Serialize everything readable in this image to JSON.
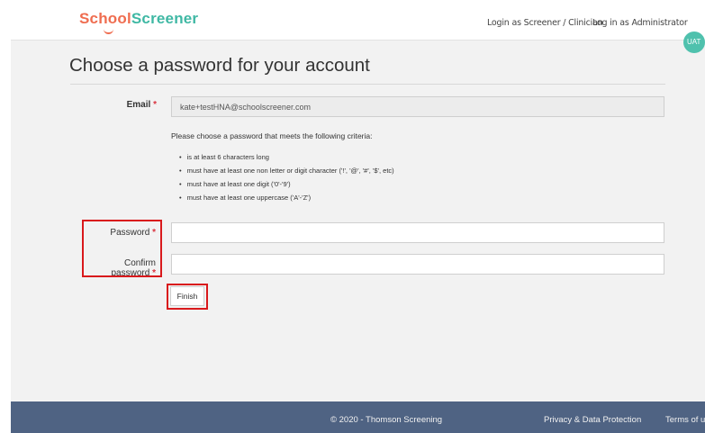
{
  "header": {
    "logo_part1": "School",
    "logo_part2": "Screener",
    "nav": {
      "screener_login": "Login as Screener / Clinician",
      "admin_login": "Log in as Administrator"
    },
    "env_badge": "UAT"
  },
  "main": {
    "title": "Choose a password for your account",
    "email_label": "Email",
    "email_value": "kate+testHNA@schoolscreener.com",
    "hint": "Please choose a password that meets the following criteria:",
    "criteria": [
      "is at least 6 characters long",
      "must have at least one non letter or digit character ('!', '@', '#', '$', etc)",
      "must have at least one digit ('0'-'9')",
      "must have at least one uppercase ('A'-'Z')"
    ],
    "password_label": "Password",
    "password_value": "",
    "confirm_label": "Confirm password",
    "confirm_value": "",
    "required_mark": "*",
    "finish_label": "Finish"
  },
  "footer": {
    "copyright": "© 2020 - Thomson Screening",
    "privacy": "Privacy & Data Protection",
    "terms": "Terms of use"
  },
  "colors": {
    "brand_orange": "#ef6d50",
    "brand_teal": "#3fb8a4",
    "footer_bg": "#4f6383",
    "required": "#d9333f",
    "highlight": "#d9191c"
  }
}
